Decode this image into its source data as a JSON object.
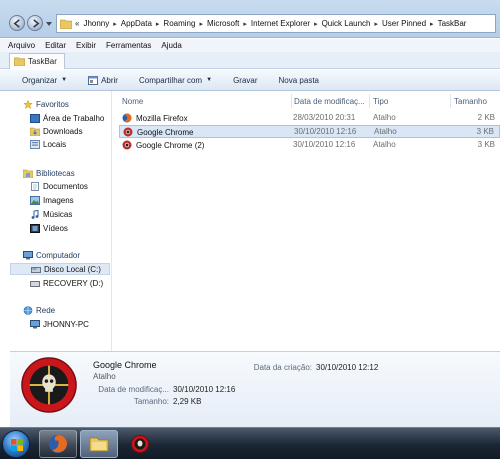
{
  "address_bar": {
    "crumbs": [
      "Jhonny",
      "AppData",
      "Roaming",
      "Microsoft",
      "Internet Explorer",
      "Quick Launch",
      "User Pinned",
      "TaskBar"
    ],
    "overflow_glyph": "«"
  },
  "menu": [
    "Arquivo",
    "Editar",
    "Exibir",
    "Ferramentas",
    "Ajuda"
  ],
  "tab": {
    "label": "TaskBar"
  },
  "commands": {
    "organize": "Organizar",
    "open": "Abrir",
    "share": "Compartilhar com",
    "burn": "Gravar",
    "new_folder": "Nova pasta"
  },
  "nav": {
    "favorites": "Favoritos",
    "fav_items": [
      "Área de Trabalho",
      "Downloads",
      "Locais"
    ],
    "libraries": "Bibliotecas",
    "lib_items": [
      "Documentos",
      "Imagens",
      "Músicas",
      "Vídeos"
    ],
    "computer": "Computador",
    "comp_items": [
      "Disco Local (C:)",
      "RECOVERY (D:)"
    ],
    "network": "Rede",
    "net_items": [
      "JHONNY-PC"
    ]
  },
  "columns": {
    "name": "Nome",
    "date": "Data de modificaç...",
    "type": "Tipo",
    "size": "Tamanho"
  },
  "files": [
    {
      "name": "Mozilla Firefox",
      "date": "28/03/2010 20:31",
      "type": "Atalho",
      "size": "2 KB",
      "icon": "firefox-icon"
    },
    {
      "name": "Google Chrome",
      "date": "30/10/2010 12:16",
      "type": "Atalho",
      "size": "3 KB",
      "icon": "chrome-icon"
    },
    {
      "name": "Google Chrome (2)",
      "date": "30/10/2010 12:16",
      "type": "Atalho",
      "size": "3 KB",
      "icon": "chrome-icon"
    }
  ],
  "details": {
    "name": "Google Chrome",
    "type": "Atalho",
    "modified_label": "Data de modificaç...",
    "modified_value": "30/10/2010 12:16",
    "size_label": "Tamanho:",
    "size_value": "2,29 KB",
    "created_label": "Data da criação:",
    "created_value": "30/10/2010 12:12"
  },
  "taskbar": {
    "buttons": [
      "start-orb",
      "firefox-icon",
      "explorer-folder-icon",
      "chrome-custom-icon"
    ]
  },
  "colors": {
    "selection": "#d8e6f6",
    "accent": "#1e395b",
    "taskbar": "#1b2634"
  }
}
